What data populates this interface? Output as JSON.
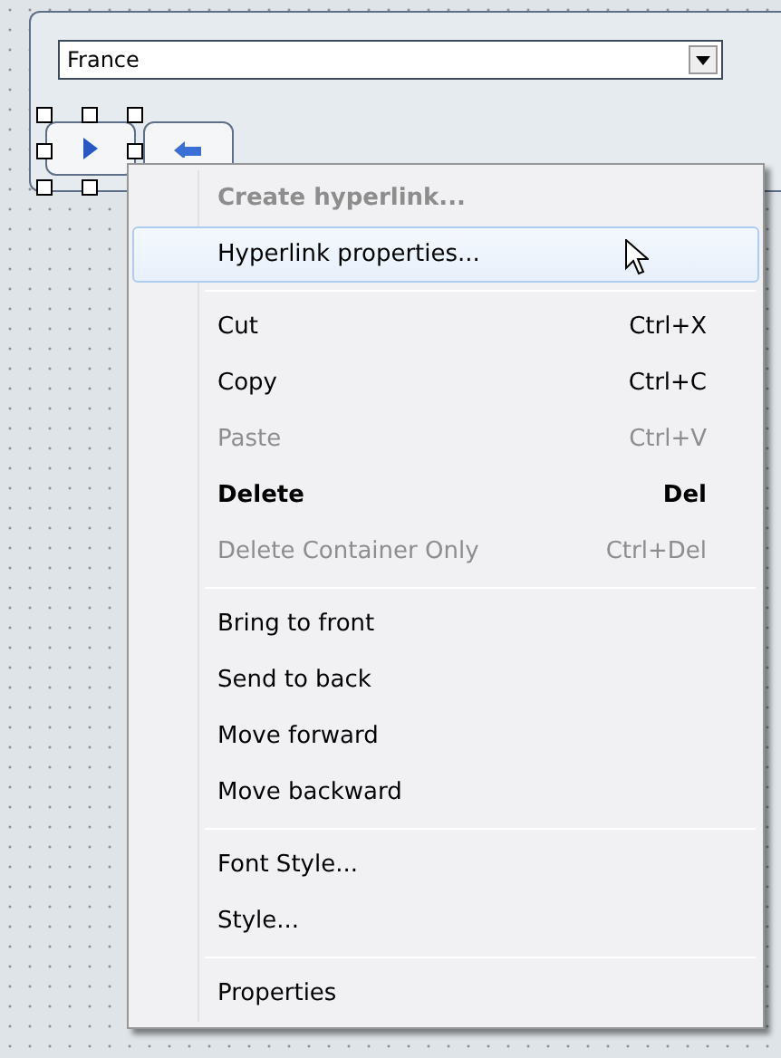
{
  "form": {
    "combo": {
      "value": "France"
    },
    "buttons": [
      {
        "kind": "play",
        "selected": true
      },
      {
        "kind": "back",
        "selected": false
      }
    ]
  },
  "context_menu": {
    "sections": [
      [
        {
          "label": "Create hyperlink...",
          "bold": true,
          "disabled": true,
          "selected": false
        },
        {
          "label": "Hyperlink properties...",
          "bold": false,
          "disabled": false,
          "selected": true
        }
      ],
      [
        {
          "label": "Cut",
          "shortcut": "Ctrl+X",
          "bold": false,
          "disabled": false,
          "selected": false
        },
        {
          "label": "Copy",
          "shortcut": "Ctrl+C",
          "bold": false,
          "disabled": false,
          "selected": false
        },
        {
          "label": "Paste",
          "shortcut": "Ctrl+V",
          "bold": false,
          "disabled": true,
          "selected": false
        },
        {
          "label": "Delete",
          "shortcut": "Del",
          "bold": true,
          "disabled": false,
          "selected": false
        },
        {
          "label": "Delete Container Only",
          "shortcut": "Ctrl+Del",
          "bold": false,
          "disabled": true,
          "selected": false
        }
      ],
      [
        {
          "label": "Bring to front",
          "bold": false,
          "disabled": false,
          "selected": false
        },
        {
          "label": "Send to back",
          "bold": false,
          "disabled": false,
          "selected": false
        },
        {
          "label": "Move forward",
          "bold": false,
          "disabled": false,
          "selected": false
        },
        {
          "label": "Move backward",
          "bold": false,
          "disabled": false,
          "selected": false
        }
      ],
      [
        {
          "label": "Font Style...",
          "bold": false,
          "disabled": false,
          "selected": false
        },
        {
          "label": "Style...",
          "bold": false,
          "disabled": false,
          "selected": false
        }
      ],
      [
        {
          "label": "Properties",
          "bold": false,
          "disabled": false,
          "selected": false
        }
      ]
    ]
  }
}
